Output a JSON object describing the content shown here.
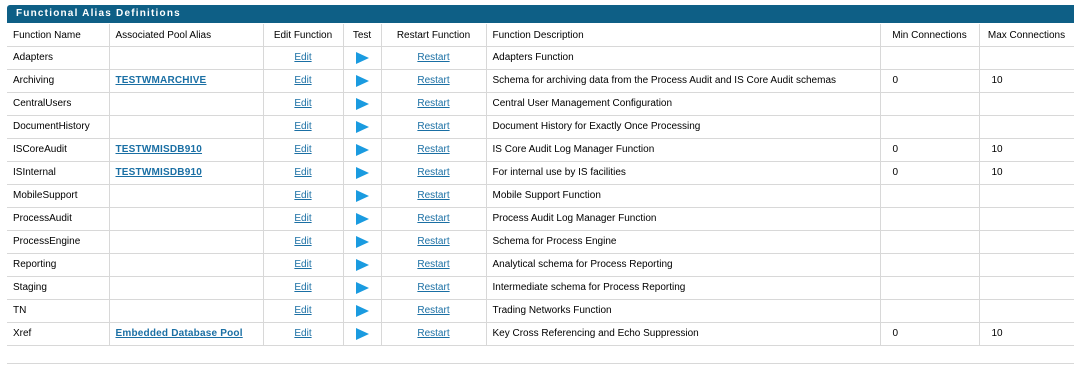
{
  "panel": {
    "title": "Functional Alias Definitions"
  },
  "columns": {
    "function_name": "Function Name",
    "pool_alias": "Associated Pool Alias",
    "edit": "Edit Function",
    "test": "Test",
    "restart": "Restart Function",
    "description": "Function Description",
    "min": "Min Connections",
    "max": "Max Connections"
  },
  "rows": [
    {
      "name": "Adapters",
      "alias": "",
      "edit": "Edit",
      "restart": "Restart",
      "description": "Adapters Function",
      "min": "",
      "max": ""
    },
    {
      "name": "Archiving",
      "alias": "TESTWMARCHIVE",
      "edit": "Edit",
      "restart": "Restart",
      "description": "Schema for archiving data from the Process Audit and IS Core Audit schemas",
      "min": "0",
      "max": "10"
    },
    {
      "name": "CentralUsers",
      "alias": "",
      "edit": "Edit",
      "restart": "Restart",
      "description": "Central User Management Configuration",
      "min": "",
      "max": ""
    },
    {
      "name": "DocumentHistory",
      "alias": "",
      "edit": "Edit",
      "restart": "Restart",
      "description": "Document History for Exactly Once Processing",
      "min": "",
      "max": ""
    },
    {
      "name": "ISCoreAudit",
      "alias": "TESTWMISDB910",
      "edit": "Edit",
      "restart": "Restart",
      "description": "IS Core Audit Log Manager Function",
      "min": "0",
      "max": "10"
    },
    {
      "name": "ISInternal",
      "alias": "TESTWMISDB910",
      "edit": "Edit",
      "restart": "Restart",
      "description": "For internal use by IS facilities",
      "min": "0",
      "max": "10"
    },
    {
      "name": "MobileSupport",
      "alias": "",
      "edit": "Edit",
      "restart": "Restart",
      "description": "Mobile Support Function",
      "min": "",
      "max": ""
    },
    {
      "name": "ProcessAudit",
      "alias": "",
      "edit": "Edit",
      "restart": "Restart",
      "description": "Process Audit Log Manager Function",
      "min": "",
      "max": ""
    },
    {
      "name": "ProcessEngine",
      "alias": "",
      "edit": "Edit",
      "restart": "Restart",
      "description": "Schema for Process Engine",
      "min": "",
      "max": ""
    },
    {
      "name": "Reporting",
      "alias": "",
      "edit": "Edit",
      "restart": "Restart",
      "description": "Analytical schema for Process Reporting",
      "min": "",
      "max": ""
    },
    {
      "name": "Staging",
      "alias": "",
      "edit": "Edit",
      "restart": "Restart",
      "description": "Intermediate schema for Process Reporting",
      "min": "",
      "max": ""
    },
    {
      "name": "TN",
      "alias": "",
      "edit": "Edit",
      "restart": "Restart",
      "description": "Trading Networks Function",
      "min": "",
      "max": ""
    },
    {
      "name": "Xref",
      "alias": "Embedded Database Pool",
      "edit": "Edit",
      "restart": "Restart",
      "description": "Key Cross Referencing and Echo Suppression",
      "min": "0",
      "max": "10"
    }
  ],
  "icons": {
    "test": "play-icon"
  },
  "colors": {
    "header_bar": "#0e5f86",
    "link": "#1a6fa4",
    "play": "#1a9be0"
  }
}
